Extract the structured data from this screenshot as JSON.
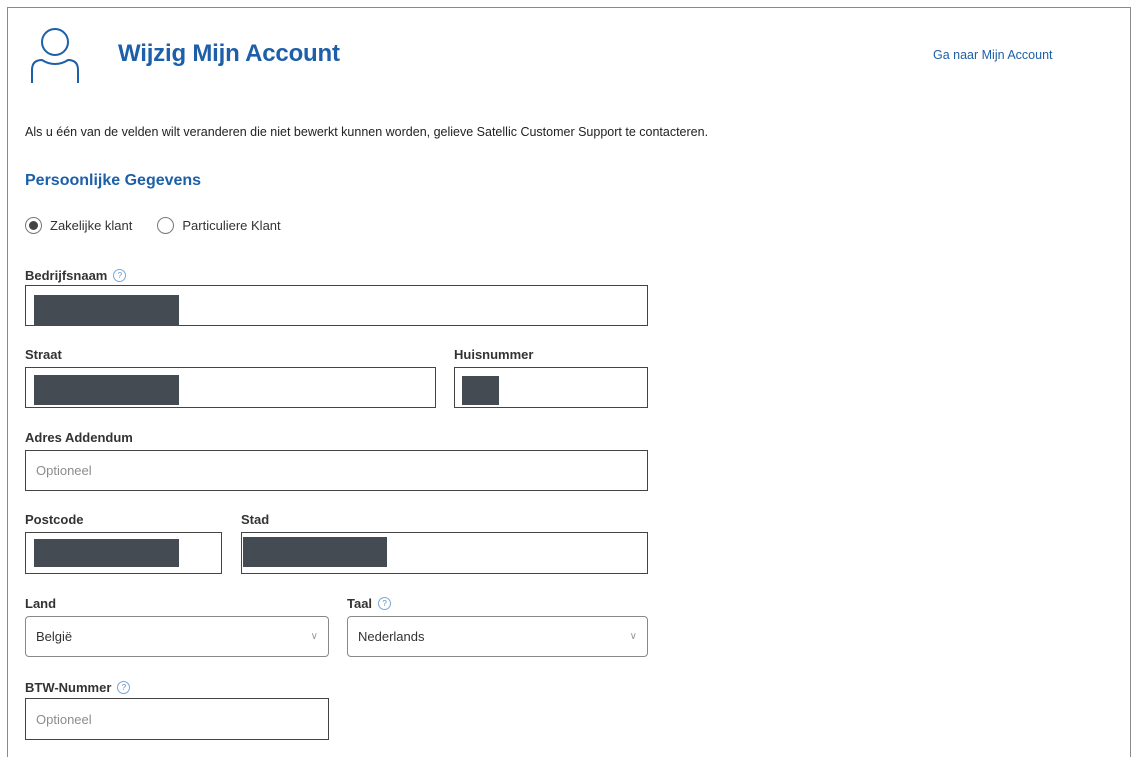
{
  "header": {
    "title": "Wijzig Mijn Account",
    "account_link": "Ga naar Mijn Account"
  },
  "intro_text": "Als u één van de velden wilt veranderen die niet bewerkt kunnen worden, gelieve Satellic Customer Support te contacteren.",
  "section_title": "Persoonlijke Gegevens",
  "customer_type": {
    "options": [
      {
        "label": "Zakelijke klant",
        "selected": true
      },
      {
        "label": "Particuliere Klant",
        "selected": false
      }
    ]
  },
  "fields": {
    "company_name": {
      "label": "Bedrijfsnaam",
      "value": ""
    },
    "street": {
      "label": "Straat",
      "value": ""
    },
    "house_number": {
      "label": "Huisnummer",
      "value": ""
    },
    "address_addendum": {
      "label": "Adres Addendum",
      "placeholder": "Optioneel"
    },
    "postcode": {
      "label": "Postcode",
      "value": ""
    },
    "city": {
      "label": "Stad",
      "value": ""
    },
    "country": {
      "label": "Land",
      "value": "België"
    },
    "language": {
      "label": "Taal",
      "value": "Nederlands"
    },
    "vat_number": {
      "label": "BTW-Nummer",
      "placeholder": "Optioneel"
    }
  },
  "icons": {
    "avatar": "user-icon",
    "help": "help-circle-icon",
    "dropdown": "chevron-down-icon"
  },
  "colors": {
    "accent": "#1d5fa8",
    "redaction": "#454b52"
  }
}
